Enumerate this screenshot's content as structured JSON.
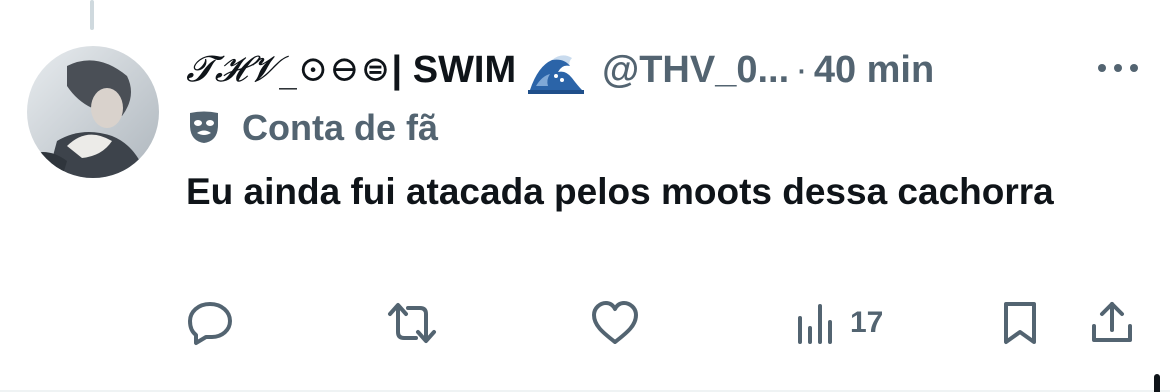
{
  "tweet": {
    "author": {
      "display_name": "𝓣𝓗𝓥_⊙⊖⊜",
      "name_suffix": " | SWIM",
      "badge_icon": "wave-icon",
      "handle": "@THV_0...",
      "avatar_icon": "avatar"
    },
    "separator": "·",
    "time": "40 min",
    "more_icon": "more-icon",
    "fan_account": {
      "icon": "theater-mask-icon",
      "label": "Conta de fã"
    },
    "text": "Eu ainda fui atacada pelos moots dessa cachorra",
    "actions": {
      "reply_icon": "reply-icon",
      "retweet_icon": "retweet-icon",
      "like_icon": "like-icon",
      "views_icon": "views-icon",
      "views_count": "17",
      "bookmark_icon": "bookmark-icon",
      "share_icon": "share-icon"
    },
    "colors": {
      "primary_text": "#0f1419",
      "secondary_text": "#536471",
      "border": "#eff3f4"
    }
  }
}
